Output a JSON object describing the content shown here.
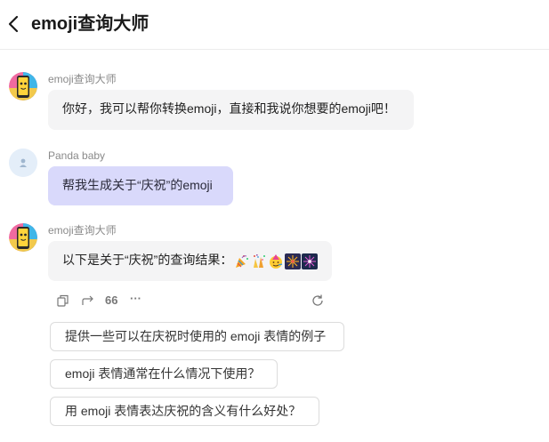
{
  "header": {
    "title": "emoji查询大师"
  },
  "messages": [
    {
      "sender": "emoji查询大师",
      "text": "你好，我可以帮你转换emoji，直接和我说你想要的emoji吧！"
    },
    {
      "sender": "Panda baby",
      "text": "帮我生成关于“庆祝”的emoji"
    },
    {
      "sender": "emoji查询大师",
      "text": "以下是关于“庆祝”的查询结果：",
      "emojis": [
        "party-popper",
        "confetti-ball",
        "partying-face",
        "fireworks",
        "sparkler"
      ]
    }
  ],
  "actions": {
    "quote_label": "66",
    "more_label": "···"
  },
  "suggestions": [
    "提供一些可以在庆祝时使用的 emoji 表情的例子",
    "emoji 表情通常在什么情况下使用？",
    "用 emoji 表情表达庆祝的含义有什么好处？"
  ],
  "icons": {
    "back": "chevron-left-icon",
    "copy": "copy-icon",
    "share": "share-icon",
    "quote": "quote-icon",
    "more": "more-icon",
    "refresh": "refresh-icon",
    "bot_avatar": "phone-character-avatar",
    "user_avatar": "person-icon"
  },
  "colors": {
    "user_bubble": "#d9d9fb",
    "bot_bubble": "#f4f4f5",
    "suggestion_border": "#dcdcdc"
  }
}
